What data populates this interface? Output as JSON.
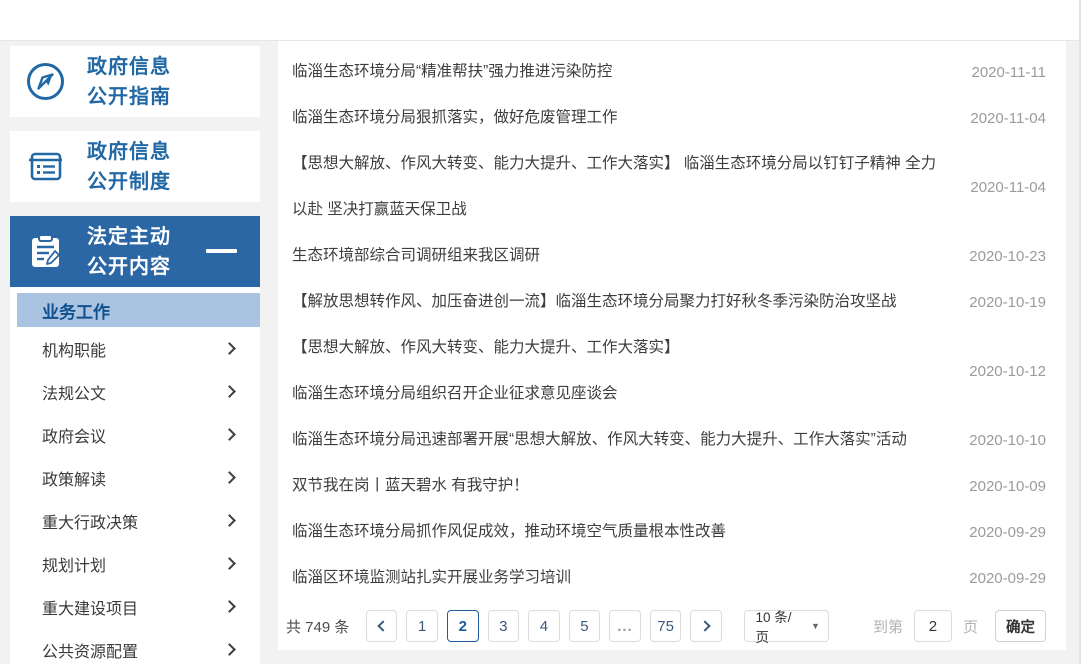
{
  "colors": {
    "accent": "#2b66a5",
    "sidebar_link": "#2268a5",
    "active_submenu_bg": "#a9c3e1",
    "page_bg": "#f2f2f2"
  },
  "sidebar": {
    "sections": [
      {
        "line1": "政府信息",
        "line2": "公开指南",
        "icon": "compass-icon",
        "selected": false
      },
      {
        "line1": "政府信息",
        "line2": "公开制度",
        "icon": "document-lines-icon",
        "selected": false
      },
      {
        "line1": "法定主动",
        "line2": "公开内容",
        "icon": "clipboard-pencil-icon",
        "selected": true,
        "collapse_icon": "minus-icon"
      }
    ],
    "menu": {
      "active_item": "业务工作",
      "items": [
        {
          "label": "机构职能"
        },
        {
          "label": "法规公文"
        },
        {
          "label": "政府会议"
        },
        {
          "label": "政策解读"
        },
        {
          "label": "重大行政决策"
        },
        {
          "label": "规划计划"
        },
        {
          "label": "重大建设项目"
        },
        {
          "label": "公共资源配置"
        }
      ]
    }
  },
  "articles": [
    {
      "title": "临淄生态环境分局“精准帮扶”强力推进污染防控",
      "date": "2020-11-11"
    },
    {
      "title": "临淄生态环境分局狠抓落实，做好危废管理工作",
      "date": "2020-11-04"
    },
    {
      "title": "【思想大解放、作风大转变、能力大提升、工作大落实】 临淄生态环境分局以钉钉子精神 全力\n以赴 坚决打赢蓝天保卫战",
      "date": "2020-11-04"
    },
    {
      "title": "生态环境部综合司调研组来我区调研",
      "date": "2020-10-23"
    },
    {
      "title": "【解放思想转作风、加压奋进创一流】临淄生态环境分局聚力打好秋冬季污染防治攻坚战",
      "date": "2020-10-19"
    },
    {
      "title": "【思想大解放、作风大转变、能力大提升、工作大落实】\n临淄生态环境分局组织召开企业征求意见座谈会",
      "date": "2020-10-12"
    },
    {
      "title": "临淄生态环境分局迅速部署开展“思想大解放、作风大转变、能力大提升、工作大落实”活动",
      "date": "2020-10-10"
    },
    {
      "title": "双节我在岗丨蓝天碧水 有我守护！",
      "date": "2020-10-09"
    },
    {
      "title": "临淄生态环境分局抓作风促成效，推动环境空气质量根本性改善",
      "date": "2020-09-29"
    },
    {
      "title": "临淄区环境监测站扎实开展业务学习培训",
      "date": "2020-09-29"
    }
  ],
  "pagination": {
    "total_label": "共 749 条",
    "pages": [
      "1",
      "2",
      "3",
      "4",
      "5",
      "...",
      "75"
    ],
    "active_page": "2",
    "page_size": "10 条/页",
    "caret": "▼",
    "jump_prefix": "到第",
    "jump_value": "2",
    "jump_suffix": "页",
    "confirm_label": "确定"
  }
}
